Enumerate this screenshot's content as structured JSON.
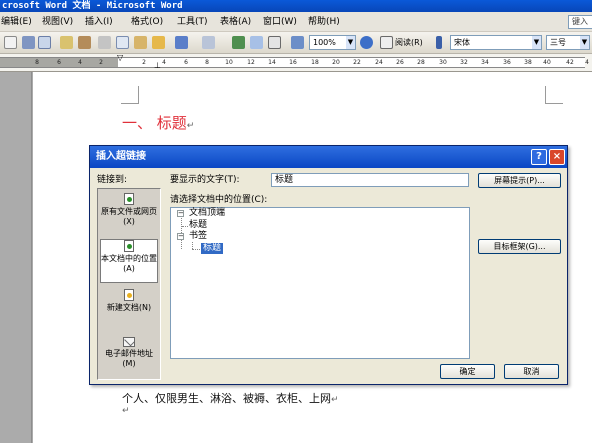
{
  "window": {
    "title": "crosoft Word 文档 - Microsoft Word"
  },
  "menu": {
    "items": [
      "编辑(E)",
      "视图(V)",
      "插入(I)",
      "格式(O)",
      "工具(T)",
      "表格(A)",
      "窗口(W)",
      "帮助(H)"
    ],
    "help_box": "键入"
  },
  "toolbar": {
    "zoom": "100%",
    "reading": "阅读(R)",
    "font": "宋体",
    "size": "三号"
  },
  "ruler": {
    "numbers": [
      "8",
      "6",
      "4",
      "2",
      "2",
      "4",
      "6",
      "8",
      "10",
      "12",
      "14",
      "16",
      "18",
      "20",
      "22",
      "24",
      "26",
      "28",
      "30",
      "32",
      "34",
      "36",
      "38",
      "40",
      "42",
      "4"
    ]
  },
  "document": {
    "heading": "一、 标题",
    "body": "个人、仅限男生、淋浴、被褥、衣柜、上网"
  },
  "dialog": {
    "title": "插入超链接",
    "help_btn": "?",
    "close_btn": "×",
    "link_to_label": "链接到:",
    "link_options": [
      "原有文件或网页(X)",
      "本文档中的位置(A)",
      "新建文档(N)",
      "电子邮件地址(M)"
    ],
    "display_text_label": "要显示的文字(T):",
    "display_text_value": "标题",
    "screen_tip_button": "屏幕提示(P)...",
    "location_label": "请选择文档中的位置(C):",
    "tree": {
      "top": "文档顶端",
      "heading": "标题",
      "bookmarks": "书签",
      "bookmark_item": "标题",
      "expander_top": "−",
      "expander_bookmarks": "−"
    },
    "target_frame_button": "目标框架(G)...",
    "ok": "确定",
    "cancel": "取消"
  }
}
